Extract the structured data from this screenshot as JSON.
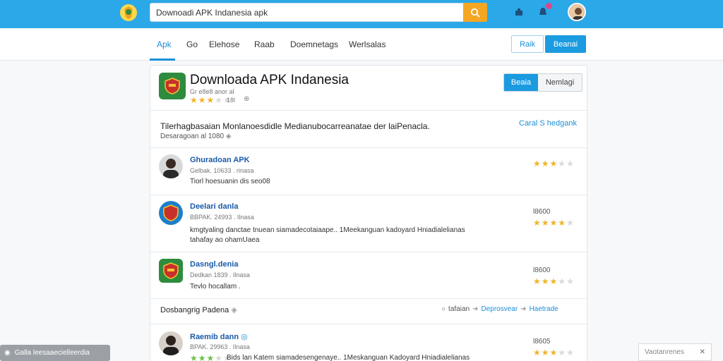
{
  "header": {
    "search_value": "Downoadi APK Indanesia apk",
    "search_icon": "search-icon",
    "icons": [
      "puzzle-icon",
      "notification-icon"
    ],
    "accent": "#2ba8e8",
    "search_button_color": "#f5a623"
  },
  "nav": {
    "tabs": [
      "Apk",
      "Go",
      "Elehose",
      "Raab",
      "Doemnetags",
      "Werlsalas"
    ],
    "active_tab": "Apk",
    "btn_outline": "Raik",
    "btn_solid": "Beanai"
  },
  "app_header": {
    "title": "Downloada APK Indanesia",
    "subtitle": "Gr e8e8 anor al",
    "rating_count": "18l",
    "rating": 3,
    "seg_left": "Beaia",
    "seg_right": "Nemlagi"
  },
  "description": {
    "line": "Tilerhagbasaian Monlanoesdidle Medianubocarreanatae der laiPenacla.",
    "sub": "Desaragoan al 1080",
    "link": "Caral S hedgank"
  },
  "rows": [
    {
      "title": "Ghuradoan APK",
      "sub": "Gelbak. 10633 . rinasa",
      "text": "Tiorl hoesuanin dis seo08",
      "right": "",
      "rating": 3
    },
    {
      "title": "Deelari danla",
      "sub": "BBPAK. 24993 . Ilnasa",
      "text": "kmgtyaling danctae tnuean siamadecotaiaape.. 1Meekanguan kadoyard Hniadialelianas",
      "text2": "tahafay ao ohamUaea",
      "right": "l8600",
      "rating": 4
    },
    {
      "title": "Dasngl.denia",
      "sub": "Dedkan 1839 . Ilnasa",
      "text": "Tevlo hocallam .",
      "right": "l8600",
      "rating": 3
    },
    {
      "title": "Raemib dann",
      "sub": "BPAK. 29963 . Ilnasa",
      "text": "Bids lan Katem siamadesengenaye..  1Meskanguan Kadoyard Hniadialelianas",
      "right": "l8605",
      "rating": 3
    }
  ],
  "footer_row": {
    "label": "Dosbangrig Padena",
    "link1": "tafaian",
    "link2": "Deprosvear",
    "link3": "Haetrade"
  },
  "toast": {
    "text": "Galla leesaaecielleerdia"
  },
  "corner": {
    "text": "Vaotanrenes"
  }
}
